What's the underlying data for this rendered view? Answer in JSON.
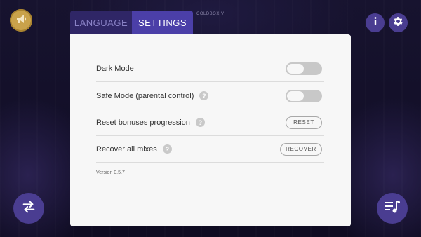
{
  "tabs": {
    "language": "LANGUAGE",
    "settings": "SETTINGS",
    "active": "settings"
  },
  "background_caption": "COLDBOX VI",
  "settings": {
    "dark_mode": {
      "label": "Dark Mode",
      "enabled": false
    },
    "safe_mode": {
      "label": "Safe Mode (parental control)",
      "enabled": false
    },
    "reset_bonuses": {
      "label": "Reset bonuses progression",
      "button": "RESET"
    },
    "recover_mixes": {
      "label": "Recover all mixes",
      "button": "RECOVER"
    }
  },
  "help_glyph": "?",
  "version": "Version 0.5.7",
  "icons": {
    "top_left": "megaphone-icon",
    "info": "info-icon",
    "settings": "gear-icon",
    "bottom_left": "swap-arrows-icon",
    "bottom_right": "music-list-icon"
  },
  "colors": {
    "accent": "#4b3fa8",
    "tab_inactive": "#2f2666",
    "round_button": "#4a3d91",
    "panel": "#f7f7f7",
    "toggle_off": "#c8c8c8",
    "logo_badge": "#c9a24b"
  }
}
